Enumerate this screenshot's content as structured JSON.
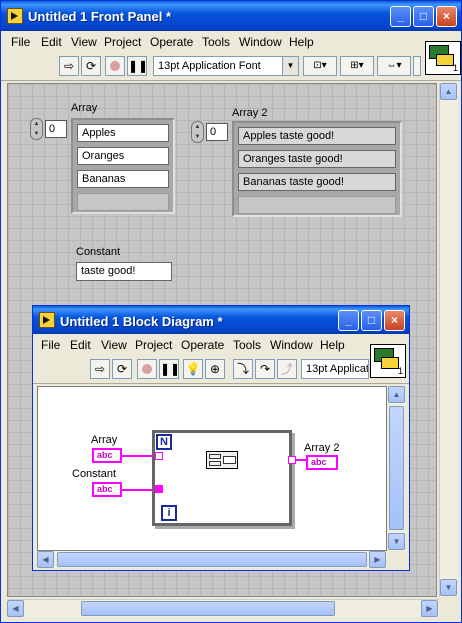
{
  "front_panel": {
    "title": "Untitled 1 Front Panel *",
    "menu": [
      "File",
      "Edit",
      "View",
      "Project",
      "Operate",
      "Tools",
      "Window",
      "Help"
    ],
    "font_selector": "13pt Application Font",
    "vi_icon_number": "1",
    "controls": {
      "array": {
        "label": "Array",
        "index": "0",
        "items": [
          "Apples",
          "Oranges",
          "Bananas",
          ""
        ]
      },
      "array2": {
        "label": "Array 2",
        "index": "0",
        "items": [
          "Apples taste good!",
          "Oranges taste good!",
          "Bananas taste good!",
          ""
        ]
      },
      "constant": {
        "label": "Constant",
        "value": "taste good!"
      }
    }
  },
  "block_diagram": {
    "title": "Untitled 1 Block Diagram *",
    "menu": [
      "File",
      "Edit",
      "View",
      "Project",
      "Operate",
      "Tools",
      "Window",
      "Help"
    ],
    "font_selector": "13pt Applicat",
    "vi_icon_number": "1",
    "nodes": {
      "array_label": "Array",
      "constant_label": "Constant",
      "array2_label": "Array 2",
      "terminal_type": "abc",
      "loop_count": "N",
      "loop_index": "i"
    }
  },
  "colors": {
    "xp_title_blue": "#0855dd",
    "panel_grid": "#c6c6c6",
    "string_wire": "#ff00ff"
  }
}
